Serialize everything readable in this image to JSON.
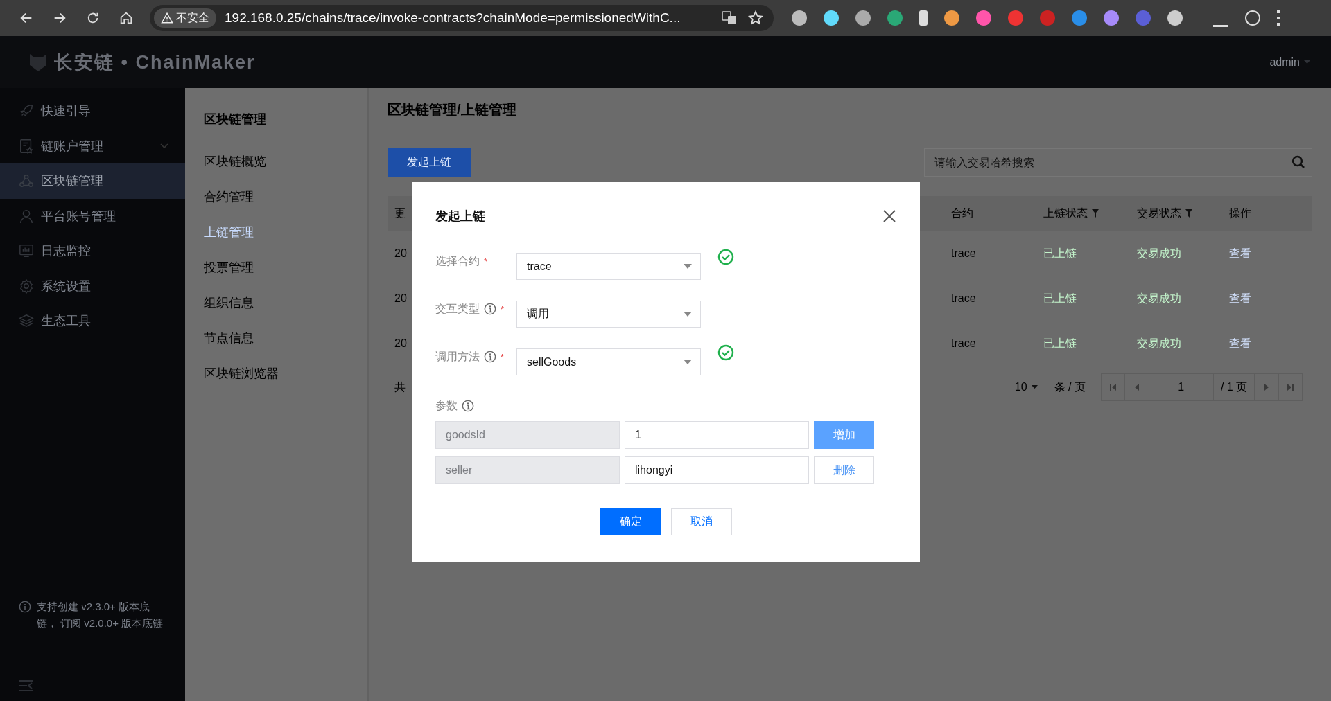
{
  "browser": {
    "security_label": "不安全",
    "url": "192.168.0.25/chains/trace/invoke-contracts?chainMode=permissionedWithC..."
  },
  "header": {
    "logo": "长安链 • ChainMaker",
    "user": "admin"
  },
  "sidebar": {
    "items": [
      {
        "label": "快速引导",
        "kind": "link",
        "selected": false
      },
      {
        "label": "链账户管理",
        "kind": "group",
        "selected": false
      },
      {
        "label": "区块链管理",
        "kind": "link",
        "selected": true
      },
      {
        "label": "平台账号管理",
        "kind": "link",
        "selected": false
      },
      {
        "label": "日志监控",
        "kind": "link",
        "selected": false
      },
      {
        "label": "系统设置",
        "kind": "link",
        "selected": false
      },
      {
        "label": "生态工具",
        "kind": "link",
        "selected": false
      }
    ],
    "note": "支持创建 v2.3.0+ 版本底链， 订阅 v2.0.0+ 版本底链"
  },
  "submenu": {
    "title": "区块链管理",
    "items": [
      {
        "label": "区块链概览",
        "selected": false
      },
      {
        "label": "合约管理",
        "selected": false
      },
      {
        "label": "上链管理",
        "selected": true
      },
      {
        "label": "投票管理",
        "selected": false
      },
      {
        "label": "组织信息",
        "selected": false
      },
      {
        "label": "节点信息",
        "selected": false
      },
      {
        "label": "区块链浏览器",
        "selected": false
      }
    ]
  },
  "page": {
    "breadcrumb": "区块链管理/上链管理",
    "primary_button": "发起上链",
    "search": {
      "placeholder": "请输入交易哈希搜索"
    },
    "table": {
      "columns": [
        {
          "label": "更",
          "filter": false
        },
        {
          "label": "合约",
          "filter": false
        },
        {
          "label": "上链状态",
          "filter": true
        },
        {
          "label": "交易状态",
          "filter": true
        },
        {
          "label": "操作",
          "filter": false
        }
      ],
      "rows": [
        {
          "column_1": "20",
          "contract": "trace",
          "chain_status": "已上链",
          "tx_status": "交易成功",
          "action": "查看"
        },
        {
          "column_1": "20",
          "contract": "trace",
          "chain_status": "已上链",
          "tx_status": "交易成功",
          "action": "查看"
        },
        {
          "column_1": "20",
          "contract": "trace",
          "chain_status": "已上链",
          "tx_status": "交易成功",
          "action": "查看"
        }
      ]
    },
    "pagination": {
      "total": "共",
      "page_size": "10",
      "per_page": "条 / 页",
      "page": "1",
      "pages": "/ 1 页"
    }
  },
  "dialog": {
    "title": "发起上链",
    "fields": [
      {
        "label": "选择合约",
        "info": false,
        "required_mark": "*",
        "value": "trace",
        "valid": true
      },
      {
        "label": "交互类型",
        "info": true,
        "required_mark": "*",
        "value": "调用",
        "valid": false
      },
      {
        "label": "调用方法",
        "info": true,
        "required_mark": "*",
        "value": "sellGoods",
        "valid": true
      }
    ],
    "params_label": "参数",
    "params": [
      {
        "key": "goodsId",
        "value": "1",
        "action": "增加",
        "kind": "add"
      },
      {
        "key": "seller",
        "value": "lihongyi",
        "action": "删除",
        "kind": "remove"
      }
    ],
    "buttons": [
      {
        "label": "确定",
        "kind": "primary"
      },
      {
        "label": "取消",
        "kind": "default"
      }
    ]
  }
}
